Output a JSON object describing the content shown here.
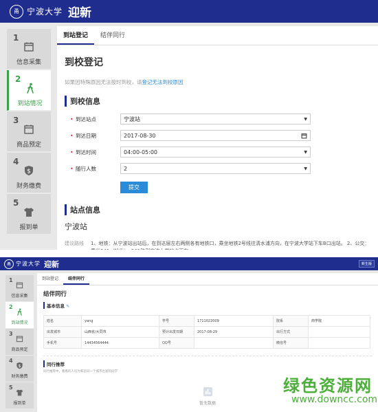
{
  "app": {
    "school_name": "宁波大学",
    "title": "迎新",
    "seal_text": "甬"
  },
  "steps": [
    {
      "num": "1",
      "label": "信息采集",
      "icon": "calendar-icon"
    },
    {
      "num": "2",
      "label": "到站情况",
      "icon": "walking-person-icon"
    },
    {
      "num": "3",
      "label": "商品预定",
      "icon": "calendar-icon"
    },
    {
      "num": "4",
      "label": "财务缴费",
      "icon": "shield-dollar-icon"
    },
    {
      "num": "5",
      "label": "报到单",
      "icon": "tshirt-icon"
    }
  ],
  "top": {
    "tabs": [
      "到站登记",
      "结伴同行"
    ],
    "heading": "到校登记",
    "hint": "如果因特殊原因无法按时到校，请",
    "hint_link": "登记无法到校原因",
    "info_heading": "到校信息",
    "fields": [
      {
        "label": "到达站点",
        "value": "宁波站",
        "control": "select"
      },
      {
        "label": "到达日期",
        "value": "2017-08-30",
        "control": "date"
      },
      {
        "label": "到达时间",
        "value": "04:00-05:00",
        "control": "select"
      },
      {
        "label": "随行人数",
        "value": "2",
        "control": "select"
      }
    ],
    "submit": "提交",
    "station_heading": "站点信息",
    "station_name": "宁波站",
    "route_label": "建议路线",
    "route_text": "1、地铁：从宁波站出站后，在到达层左右两侧各有地铁口，乘坐地铁2号线往清水浦方向，在宁波大学站下车B口出站。 2、公交：乘坐541（始发）、501路到宁波大学站点下车。"
  },
  "bottom": {
    "new_student_btn": "新生版",
    "tabs": [
      "到站登记",
      "结伴同行"
    ],
    "heading": "结伴同行",
    "basic_info": "基本信息",
    "table": [
      [
        "姓名",
        "yang",
        "学号",
        "1711022009",
        "院系",
        "商学院"
      ],
      [
        "出发城市",
        "山西省/大同市",
        "预计出发日期",
        "2017-08-29",
        "出行方式",
        ""
      ],
      [
        "手机号",
        "14434564444",
        "QQ号",
        "",
        "微信号",
        ""
      ]
    ],
    "recommend_heading": "同行推荐",
    "recommend_hint": "同行推荐中，看看的人均为和您同一个城市出发的同学",
    "empty_text": "暂无数据"
  },
  "watermark": {
    "text": "绿色资源网",
    "url": "www.downcc.com"
  },
  "colors": {
    "brand": "#1f2e8e",
    "active": "#3aa34a",
    "link": "#2a8bd8"
  }
}
